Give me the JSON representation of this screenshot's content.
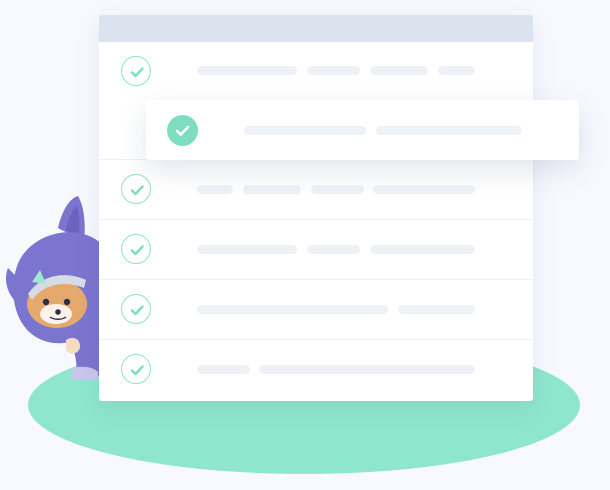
{
  "illustration": {
    "description_icon": "task-checklist",
    "colors": {
      "background": "#f7f9fe",
      "ellipse": "#8ee6cc",
      "card": "#ffffff",
      "header": "#dbe4ee",
      "check_stroke": "#8de3c9",
      "check_fill": "#7fddbf",
      "placeholder_bar": "#eef1f6",
      "mascot_body": "#7b75cf",
      "mascot_face": "#e4a96c"
    }
  },
  "checklist": {
    "rows": [
      {
        "checked": true,
        "highlighted": false
      },
      {
        "checked": true,
        "highlighted": true
      },
      {
        "checked": true,
        "highlighted": false
      },
      {
        "checked": true,
        "highlighted": false
      },
      {
        "checked": true,
        "highlighted": false
      },
      {
        "checked": true,
        "highlighted": false
      }
    ]
  }
}
